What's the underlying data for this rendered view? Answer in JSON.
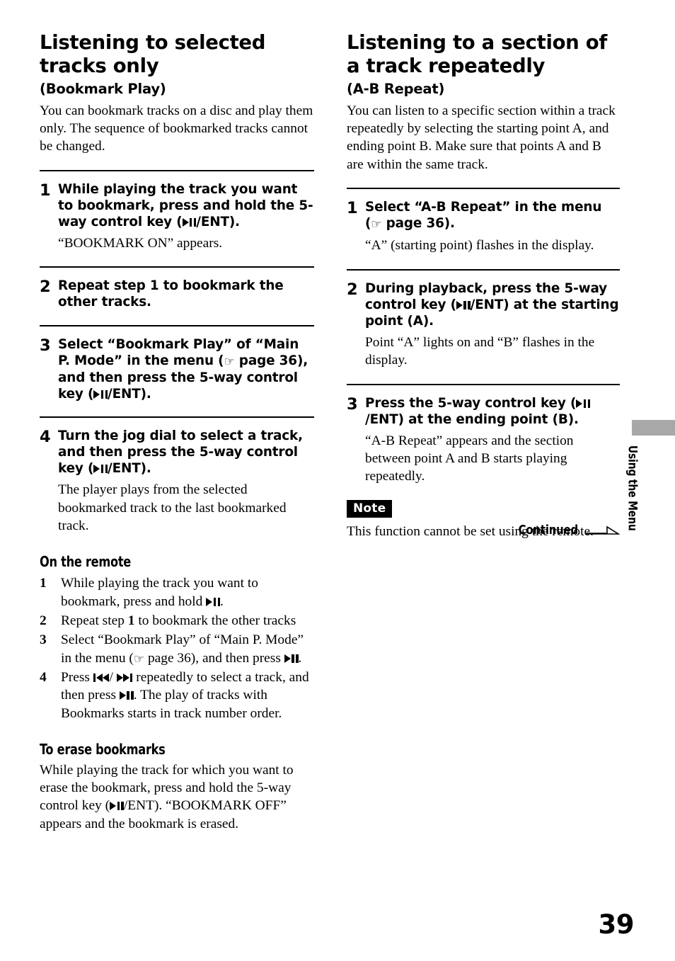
{
  "page": {
    "number": "39",
    "side_tab_label": "Using the Menu",
    "continued_label": "Continued"
  },
  "left_column": {
    "heading": "Listening to selected tracks only",
    "subheading": "(Bookmark Play)",
    "intro": "You can bookmark tracks on a disc and play them only. The sequence of bookmarked tracks cannot be changed.",
    "steps": [
      {
        "number": "1",
        "title_part1": "While playing the track you want to bookmark, press and hold the 5-way control key (",
        "title_part2": "/ENT).",
        "desc": "“BOOKMARK ON” appears."
      },
      {
        "number": "2",
        "title_part1": "Repeat step 1 to bookmark the other tracks.",
        "title_part2": "",
        "desc": ""
      },
      {
        "number": "3",
        "title_part1": "Select  “Bookmark Play”  of “Main P. Mode” in the menu (",
        "title_mid": " page 36), and then press the 5-way control key (",
        "title_part2": "/ENT).",
        "desc": ""
      },
      {
        "number": "4",
        "title_part1": "Turn the jog dial to select a track, and then press the 5-way control key  (",
        "title_part2": "/ENT).",
        "desc": "The player plays from the selected bookmarked track to the last bookmarked track."
      }
    ],
    "remote_heading": "On the remote",
    "remote_steps": [
      {
        "number": "1",
        "text_before": "While playing the track you want to bookmark, press and hold ",
        "text_after": "."
      },
      {
        "number": "2",
        "text_before": "Repeat step ",
        "bold_ref": "1",
        "text_after": " to bookmark the other tracks"
      },
      {
        "number": "3",
        "text_before": "Select “Bookmark Play” of “Main P. Mode” in the menu (",
        "text_mid": " page 36), and then press ",
        "text_after": "."
      },
      {
        "number": "4",
        "text_before": "Press ",
        "text_mid": " repeatedly to select a track, and then press ",
        "text_after": ". The play of tracks with Bookmarks starts in track number order."
      }
    ],
    "erase_heading": "To erase bookmarks",
    "erase_text_before": "While playing the track for which you want to erase the bookmark, press and hold the 5-way control key (",
    "erase_text_after": "/ENT). “BOOKMARK OFF” appears and the bookmark is erased."
  },
  "right_column": {
    "heading": "Listening to a section of a track repeatedly",
    "subheading": "(A-B Repeat)",
    "intro": "You can listen to a specific section within a track repeatedly by selecting the starting point A, and ending point B. Make sure that points A and B are within the same track.",
    "steps": [
      {
        "number": "1",
        "title_part1": "Select  “A-B Repeat” in the menu (",
        "title_part2": " page 36).",
        "desc": " “A” (starting point) flashes in the display."
      },
      {
        "number": "2",
        "title_part1": "During playback, press the 5-way control key (",
        "title_part2": "/ENT) at the starting point (A).",
        "desc": "Point “A” lights on and “B” flashes in the display."
      },
      {
        "number": "3",
        "title_part1": "Press the 5-way control key (",
        "title_part2": "/ENT) at the ending point (B).",
        "desc": "“A-B Repeat” appears and the section between point A and B starts playing repeatedly."
      }
    ],
    "note_badge": "Note",
    "note_text": "This function cannot be set using the remote."
  },
  "icons": {
    "reference_hand": "☞",
    "play_pause": "play-pause",
    "prev_track": "prev-track",
    "next_track": "next-track"
  },
  "colors": {
    "text": "#000000",
    "background": "#ffffff",
    "side_tab_gray": "#a8a8a8",
    "note_badge_bg": "#000000"
  }
}
